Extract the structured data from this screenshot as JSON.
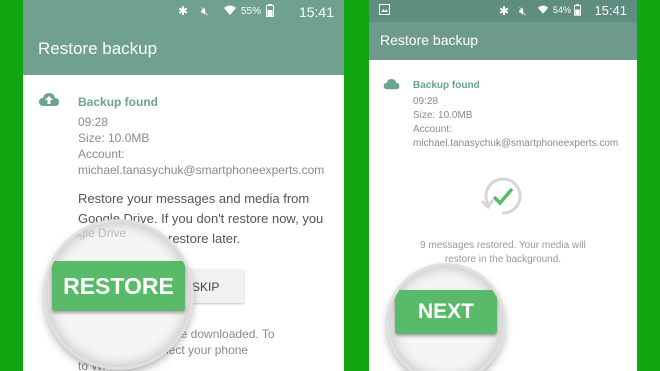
{
  "colors": {
    "background": "#11a611",
    "appbar": "#6fa090",
    "accent": "#59bb6a",
    "label": "#6aa392"
  },
  "left": {
    "status": {
      "time": "15:41",
      "battery": "55%"
    },
    "title": "Restore backup",
    "backup": {
      "heading": "Backup found",
      "time": "09:28",
      "size": "Size: 10.0MB",
      "account_label": "Account:",
      "account": "michael.tanasychuk@smartphoneexperts.com"
    },
    "body": {
      "line1": "Restore your messages and media from",
      "line2": "Google Drive. If you don't restore now, you",
      "line3": "restore later."
    },
    "skip_label": "SKIP",
    "restore_label": "RESTORE",
    "footer": {
      "line1": "be downloaded. To",
      "line2": "sage, connect your phone",
      "line3": "to Wi-Fi."
    },
    "magnified_bg_text": "Google Drive"
  },
  "right": {
    "status": {
      "time": "15:41",
      "battery": "54%"
    },
    "title": "Restore backup",
    "backup": {
      "heading": "Backup found",
      "time": "09:28",
      "size": "Size: 10.0MB",
      "account_label": "Account:",
      "account": "michael.tanasychuk@smartphoneexperts.com"
    },
    "restored": {
      "line1": "9 messages restored. Your media will",
      "line2": "restore in the background."
    },
    "next_label": "NEXT"
  },
  "icons": [
    "bluetooth-icon",
    "mute-icon",
    "wifi-icon",
    "battery-icon",
    "cloud-upload-icon",
    "cloud-icon",
    "restore-check-icon",
    "image-notification-icon"
  ]
}
